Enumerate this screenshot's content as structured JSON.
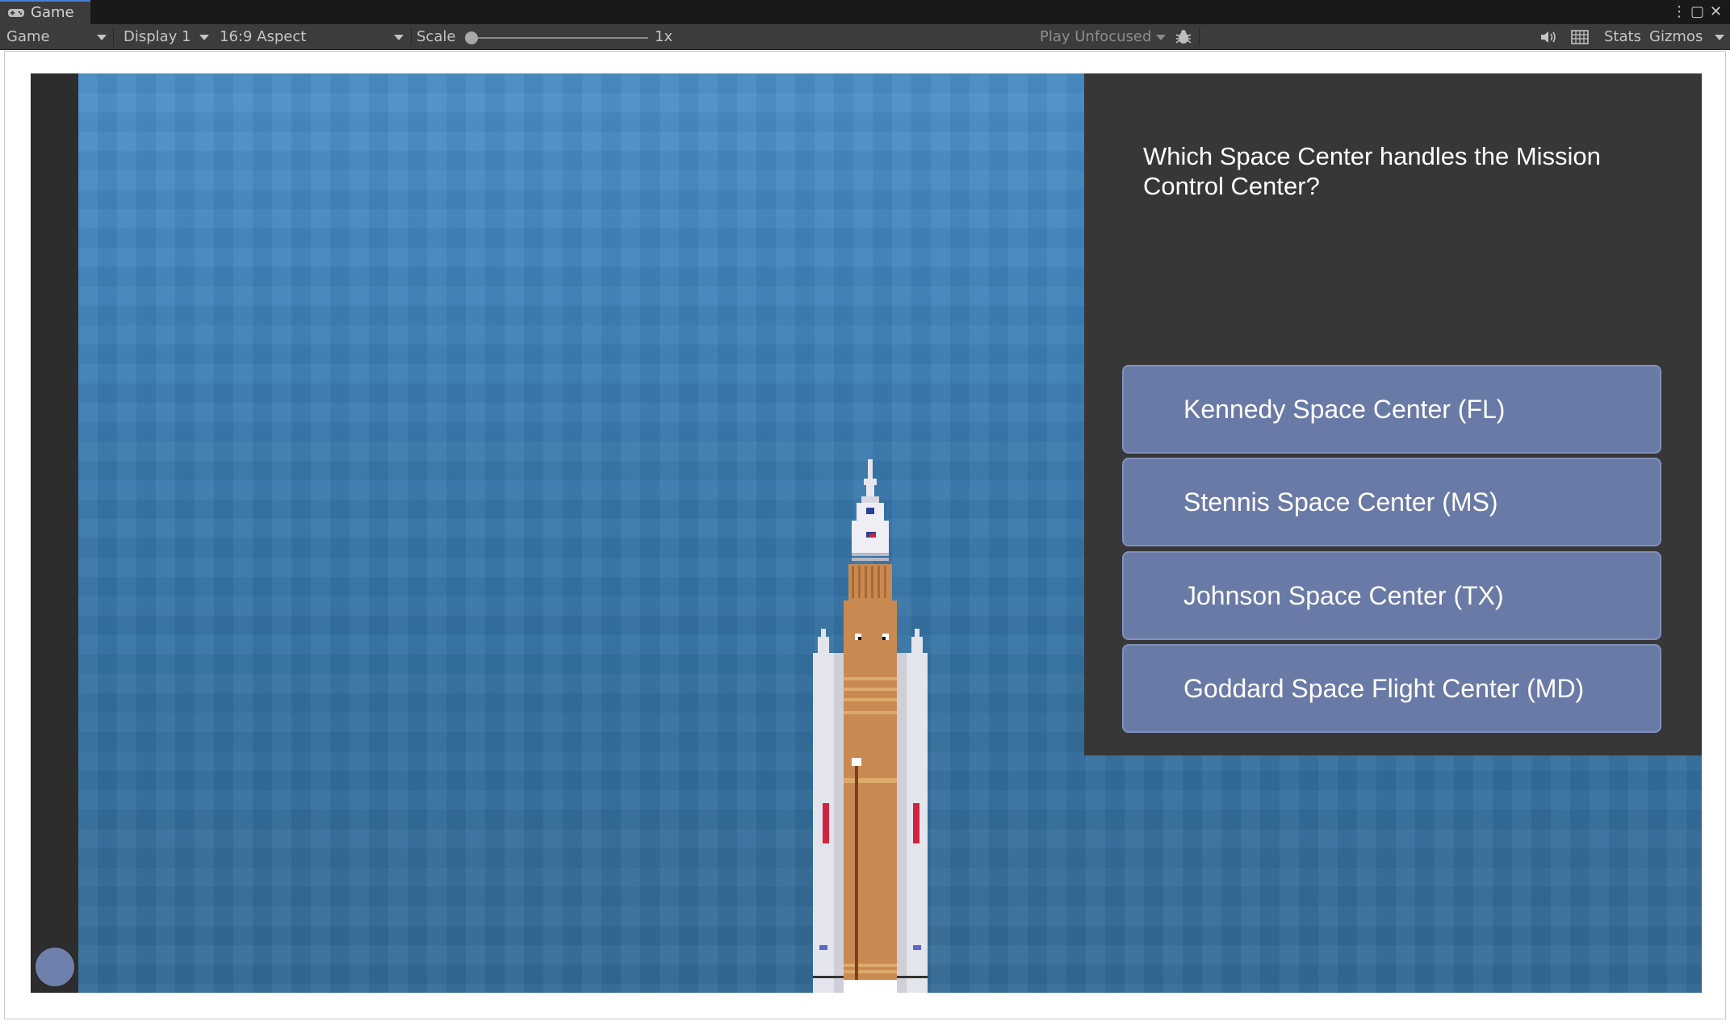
{
  "window": {
    "tab_title": "Game",
    "controls": {
      "more": "⋮",
      "maximize": "▢",
      "close": "✕"
    }
  },
  "toolbar": {
    "view_mode": "Game",
    "display": "Display 1",
    "aspect": "16:9 Aspect",
    "scale_label": "Scale",
    "scale_value": "1x",
    "play_mode": "Play Unfocused",
    "stats": "Stats",
    "gizmos": "Gizmos"
  },
  "icons": {
    "tab": "gamepad-icon",
    "bug": "bug-icon",
    "audio": "speaker-icon",
    "grid": "keyboard-grid-icon"
  },
  "quiz": {
    "question": "Which Space Center handles the Mission Control Center?",
    "answers": [
      "Kennedy Space Center (FL)",
      "Stennis Space Center (MS)",
      "Johnson Space Center (TX)",
      "Goddard Space Flight Center (MD)"
    ]
  },
  "colors": {
    "sky_top": "#4a8fc8",
    "sky_bottom": "#356b96",
    "panel": "#373737",
    "answer_button": "#6a7aa6",
    "rocket_core": "#c98a52",
    "booster": "#e4e4ec"
  }
}
